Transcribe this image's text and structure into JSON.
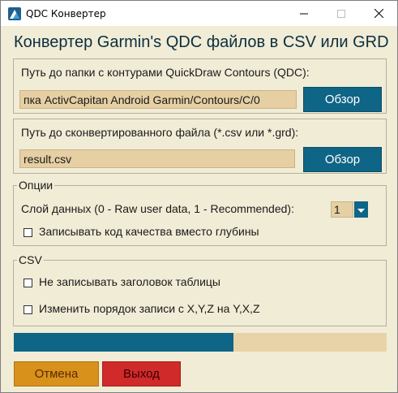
{
  "window": {
    "title": "QDC Конвертер"
  },
  "header": {
    "title": "Конвертер Garmin's QDC файлов в CSV или GRD"
  },
  "input_folder": {
    "label": "Путь до папки с контурами QuickDraw Contours (QDC):",
    "value": "пка ActivCapitan Android Garmin/Contours/C/0",
    "browse_label": "Обзор"
  },
  "output_file": {
    "label": "Путь до сконвертированного файла (*.csv или *.grd):",
    "value": "result.csv",
    "browse_label": "Обзор"
  },
  "options": {
    "legend": "Опции",
    "layer_label": "Слой данных (0 - Raw user data, 1 - Recommended):",
    "layer_value": "1",
    "quality_label": "Записывать код качества вместо глубины",
    "quality_checked": false
  },
  "csv": {
    "legend": "CSV",
    "no_header_label": "Не записывать заголовок таблицы",
    "no_header_checked": false,
    "swap_xy_label": "Изменить порядок записи с X,Y,Z на Y,X,Z",
    "swap_xy_checked": false
  },
  "progress": {
    "value": 0.59
  },
  "footer": {
    "cancel_label": "Отмена",
    "exit_label": "Выход"
  },
  "colors": {
    "background": "#f1ecd6",
    "accent_blue": "#0e6585",
    "field_fill": "#e5cfa3",
    "cancel_orange": "#d8911b",
    "exit_red": "#d02a2a",
    "title_text": "#0b2f3f"
  },
  "icons": {
    "app": "app-logo-icon",
    "minimize": "minimize-icon",
    "maximize": "maximize-icon",
    "close": "close-icon",
    "spinner": "chevron-down-icon"
  }
}
